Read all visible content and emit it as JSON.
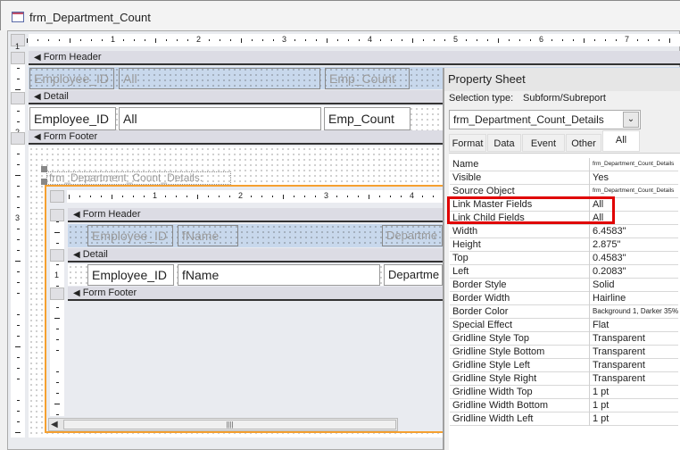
{
  "window": {
    "title": "frm_Department_Count"
  },
  "main_form": {
    "sections": {
      "header": "Form Header",
      "detail": "Detail",
      "footer": "Form Footer"
    },
    "header_labels": [
      "Employee_ID",
      "All",
      "Emp_Count"
    ],
    "detail_fields": [
      "Employee_ID",
      "All",
      "Emp_Count"
    ],
    "ruler_numbers": [
      "1",
      "2",
      "3",
      "4",
      "5",
      "6",
      "7"
    ]
  },
  "subform": {
    "label": "frm_Department_Count_Details:",
    "sections": {
      "header": "Form Header",
      "detail": "Detail",
      "footer": "Form Footer"
    },
    "header_labels": [
      "Employee_ID",
      "fName",
      "Departme"
    ],
    "detail_fields": [
      "Employee_ID",
      "fName",
      "Departme"
    ],
    "ruler_numbers": [
      "1",
      "2",
      "3",
      "4"
    ],
    "side_ruler_numbers": [
      "1"
    ]
  },
  "side_ruler_numbers": [
    "1",
    "2",
    "3"
  ],
  "property_sheet": {
    "title": "Property Sheet",
    "selection_type_label": "Selection type:",
    "selection_type": "Subform/Subreport",
    "object_combo": "frm_Department_Count_Details",
    "tabs": [
      "Format",
      "Data",
      "Event",
      "Other",
      "All"
    ],
    "active_tab": "All",
    "highlight_color": "#e00000",
    "rows": [
      {
        "k": "Name",
        "v": "frm_Department_Count_Details"
      },
      {
        "k": "Visible",
        "v": "Yes"
      },
      {
        "k": "Source Object",
        "v": "frm_Department_Count_Details"
      },
      {
        "k": "Link Master Fields",
        "v": "All"
      },
      {
        "k": "Link Child Fields",
        "v": "All"
      },
      {
        "k": "Width",
        "v": "6.4583\""
      },
      {
        "k": "Height",
        "v": "2.875\""
      },
      {
        "k": "Top",
        "v": "0.4583\""
      },
      {
        "k": "Left",
        "v": "0.2083\""
      },
      {
        "k": "Border Style",
        "v": "Solid"
      },
      {
        "k": "Border Width",
        "v": "Hairline"
      },
      {
        "k": "Border Color",
        "v": "Background 1, Darker 35%"
      },
      {
        "k": "Special Effect",
        "v": "Flat"
      },
      {
        "k": "Gridline Style Top",
        "v": "Transparent"
      },
      {
        "k": "Gridline Style Bottom",
        "v": "Transparent"
      },
      {
        "k": "Gridline Style Left",
        "v": "Transparent"
      },
      {
        "k": "Gridline Style Right",
        "v": "Transparent"
      },
      {
        "k": "Gridline Width Top",
        "v": "1 pt"
      },
      {
        "k": "Gridline Width Bottom",
        "v": "1 pt"
      },
      {
        "k": "Gridline Width Left",
        "v": "1 pt"
      }
    ]
  }
}
